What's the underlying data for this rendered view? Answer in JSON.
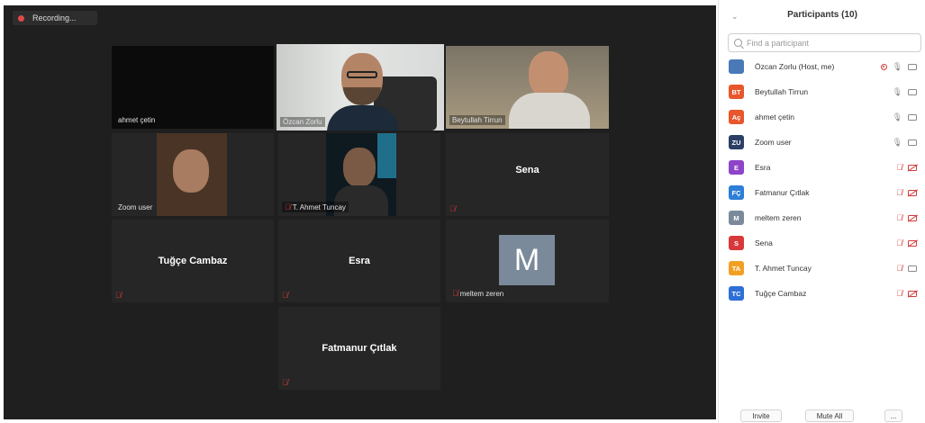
{
  "recording": {
    "label": "Recording..."
  },
  "tiles": [
    {
      "name": "ahmet çetin"
    },
    {
      "name": "Özcan Zorlu"
    },
    {
      "name": "Beytullah Tirrun"
    },
    {
      "name": "Zoom user"
    },
    {
      "name": "T. Ahmet Tuncay"
    },
    {
      "name": "Sena"
    },
    {
      "name": "Tuğçe Cambaz"
    },
    {
      "name": "Esra"
    },
    {
      "name": "meltem zeren",
      "avatar_letter": "M"
    },
    {
      "name": "Fatmanur Çıtlak"
    }
  ],
  "panel": {
    "title": "Participants (10)",
    "search_placeholder": "Find a participant",
    "invite_label": "Invite",
    "mute_all_label": "Mute All",
    "more_label": "...",
    "participants": [
      {
        "initials": "",
        "name": "Özcan Zorlu (Host, me)",
        "color": "#4a79b8",
        "mic": "on",
        "cam": "on",
        "recording": true
      },
      {
        "initials": "BT",
        "name": "Beytullah Tirrun",
        "color": "#e8562c",
        "mic": "on",
        "cam": "on"
      },
      {
        "initials": "Aç",
        "name": "ahmet çetin",
        "color": "#e8562c",
        "mic": "on",
        "cam": "on"
      },
      {
        "initials": "ZU",
        "name": "Zoom user",
        "color": "#2b3f66",
        "mic": "on",
        "cam": "on"
      },
      {
        "initials": "E",
        "name": "Esra",
        "color": "#8e44c9",
        "mic": "off",
        "cam": "off"
      },
      {
        "initials": "FÇ",
        "name": "Fatmanur Çıtlak",
        "color": "#2d7ed6",
        "mic": "off",
        "cam": "off"
      },
      {
        "initials": "M",
        "name": "meltem zeren",
        "color": "#7a8a9a",
        "mic": "off",
        "cam": "off"
      },
      {
        "initials": "S",
        "name": "Sena",
        "color": "#d9383a",
        "mic": "off",
        "cam": "off"
      },
      {
        "initials": "TA",
        "name": "T. Ahmet Tuncay",
        "color": "#f2a024",
        "mic": "off",
        "cam": "on"
      },
      {
        "initials": "TC",
        "name": "Tuğçe Cambaz",
        "color": "#2d6fd6",
        "mic": "off",
        "cam": "off"
      }
    ]
  }
}
